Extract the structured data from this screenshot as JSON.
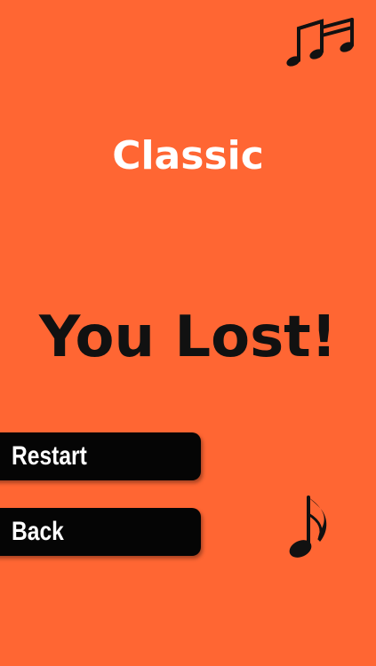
{
  "screen": {
    "background_color": "#FF6633"
  },
  "icons": {
    "top_right": "beamed-sixteenth-notes-icon",
    "bottom_right": "eighth-note-icon"
  },
  "game": {
    "mode_title": "Classic",
    "result_title": "You Lost!"
  },
  "menu": {
    "restart_label": "Restart",
    "back_label": "Back"
  }
}
